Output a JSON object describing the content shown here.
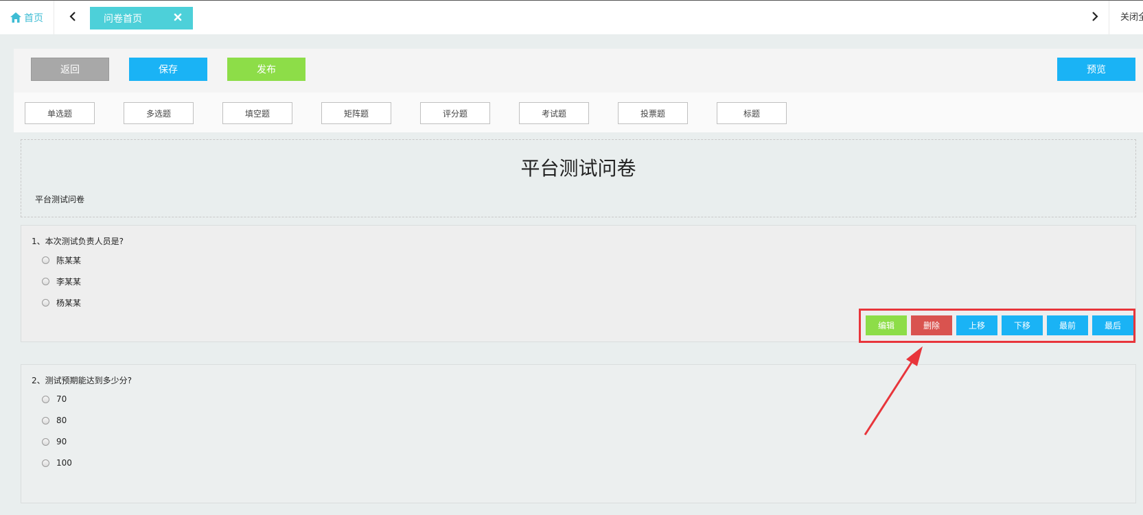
{
  "topbar": {
    "home_label": "首页",
    "active_tab": "问卷首页",
    "close_all_label": "关闭全部",
    "home_icon": "home-icon",
    "tab_close_icon": "close-icon",
    "nav_prev_icon": "chevron-left-icon",
    "nav_next_icon": "chevron-right-icon"
  },
  "toolbar": {
    "back_label": "返回",
    "save_label": "保存",
    "publish_label": "发布",
    "preview_label": "预览"
  },
  "question_types": [
    "单选题",
    "多选题",
    "填空题",
    "矩阵题",
    "评分题",
    "考试题",
    "投票题",
    "标题"
  ],
  "survey": {
    "title": "平台测试问卷",
    "description": "平台测试问卷"
  },
  "questions": [
    {
      "title": "1、本次测试负责人员是?",
      "options": [
        "陈某某",
        "李某某",
        "杨某某"
      ],
      "actions": {
        "edit": "编辑",
        "delete": "删除",
        "move_up": "上移",
        "move_down": "下移",
        "move_first": "最前",
        "move_last": "最后"
      }
    },
    {
      "title": "2、测试预期能达到多少分?",
      "options": [
        "70",
        "80",
        "90",
        "100"
      ]
    }
  ],
  "colors": {
    "primary_blue": "#1ab3f5",
    "green": "#8ddd48",
    "red": "#d9534f",
    "tab_cyan": "#4dd0d9",
    "annotation_red": "#e8353b"
  }
}
